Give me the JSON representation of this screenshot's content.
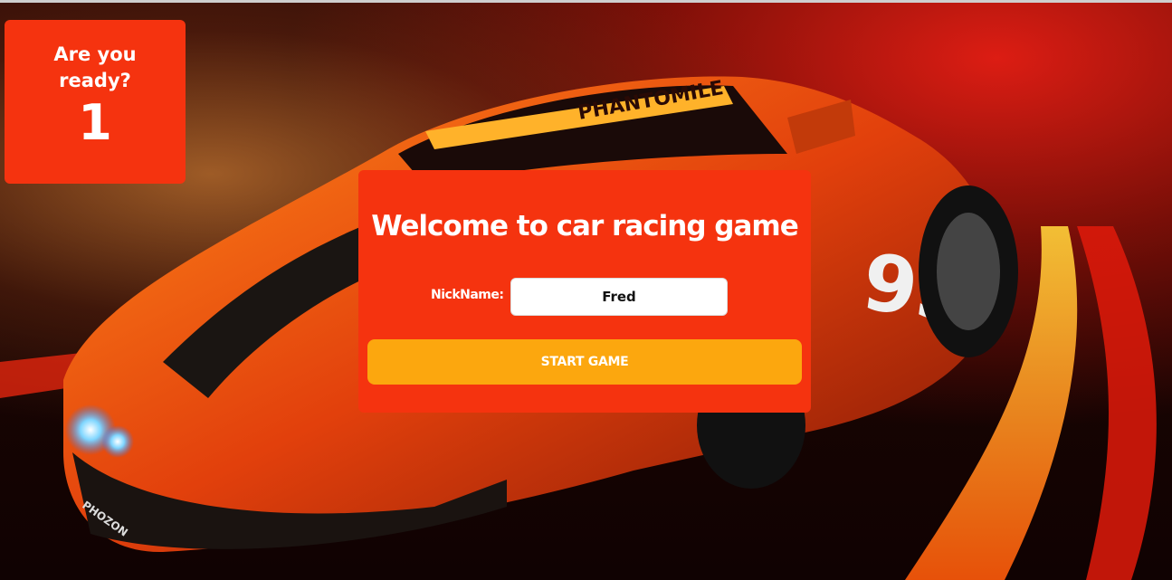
{
  "countdown": {
    "title": "Are you ready?",
    "value": "1"
  },
  "welcome": {
    "title": "Welcome to car racing game",
    "nickname_label": "NickName:",
    "nickname_value": "Fred",
    "start_button": "START GAME"
  },
  "background": {
    "hood_text": "PHANTOMILE",
    "race_number": "93",
    "side_text": "PHOZON",
    "accent_color": "#f5330f",
    "button_color": "#fca70e"
  }
}
